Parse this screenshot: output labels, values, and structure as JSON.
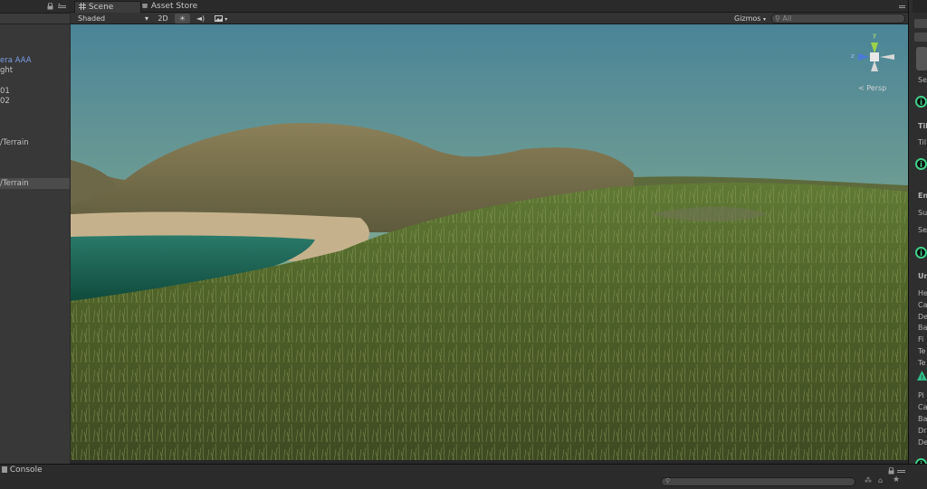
{
  "hierarchy": {
    "items": [
      {
        "label": "era AAA",
        "style": "blue"
      },
      {
        "label": "ght",
        "style": ""
      },
      {
        "label": "01",
        "style": ""
      },
      {
        "label": "02",
        "style": ""
      },
      {
        "label": "/Terrain",
        "style": ""
      },
      {
        "label": "/Terrain",
        "style": "sel"
      }
    ],
    "lock_icon": "lock-icon",
    "menu_icon": "panel-menu-icon"
  },
  "scene": {
    "tabs": [
      {
        "label": "Scene",
        "icon": "scene-grid-icon"
      },
      {
        "label": "Asset Store",
        "icon": "asset-store-icon"
      }
    ],
    "toolbar": {
      "draw_mode": "Shaded",
      "mode_2d": "2D",
      "gizmos_label": "Gizmos",
      "search_placeholder": "All"
    },
    "gizmo": {
      "y_label": "y",
      "z_label": "z",
      "projection_label": "Persp"
    }
  },
  "inspector": {
    "labels": [
      "Se",
      "Til",
      "Til",
      "En",
      "Su",
      "Se",
      "Un",
      "He",
      "Ca",
      "De",
      "Ba",
      "Fi",
      "Te",
      "Te",
      "Pi",
      "Ca",
      "Ba",
      "Dr",
      "De"
    ],
    "info_glyph": "i",
    "warning_glyph": "!"
  },
  "console": {
    "tab_label": "Console",
    "icon": "console-icon"
  },
  "colors": {
    "panel_bg": "#383838",
    "toolbar_bg": "#333333",
    "sky_top": "#4a8497",
    "sky_horizon": "#c7cf93",
    "grass": "#556b2f",
    "water": "#1f6a5a",
    "accent_info": "#3fcf8a",
    "selected_text": "#7a9ee8"
  }
}
